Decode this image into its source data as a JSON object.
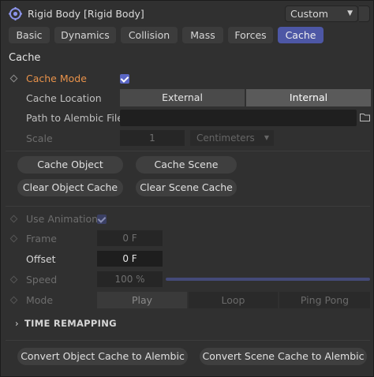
{
  "header": {
    "title": "Rigid Body [Rigid Body]",
    "preset": "Custom",
    "icon": "rigid-body-icon"
  },
  "tabs": [
    {
      "label": "Basic"
    },
    {
      "label": "Dynamics"
    },
    {
      "label": "Collision"
    },
    {
      "label": "Mass"
    },
    {
      "label": "Forces"
    },
    {
      "label": "Cache",
      "active": true
    }
  ],
  "section": "Cache",
  "cache_mode": {
    "label": "Cache Mode",
    "checked": true
  },
  "cache_location": {
    "label": "Cache Location",
    "options": [
      "External",
      "Internal"
    ],
    "selected": "Internal"
  },
  "alembic": {
    "label": "Path to Alembic File",
    "value": ""
  },
  "scale": {
    "label": "Scale",
    "value": "1",
    "unit": "Centimeters"
  },
  "buttons": {
    "cache_object": "Cache Object",
    "cache_scene": "Cache Scene",
    "clear_object": "Clear Object Cache",
    "clear_scene": "Clear Scene Cache",
    "convert_object": "Convert Object Cache to Alembic",
    "convert_scene": "Convert Scene Cache to Alembic"
  },
  "use_animation": {
    "label": "Use Animation",
    "checked": true
  },
  "frame": {
    "label": "Frame",
    "value": "0 F"
  },
  "offset": {
    "label": "Offset",
    "value": "0 F"
  },
  "speed": {
    "label": "Speed",
    "value": "100 %",
    "fraction": 1.0
  },
  "mode": {
    "label": "Mode",
    "options": [
      "Play",
      "Loop",
      "Ping Pong"
    ],
    "selected": "Play"
  },
  "time_remapping": "TIME REMAPPING"
}
